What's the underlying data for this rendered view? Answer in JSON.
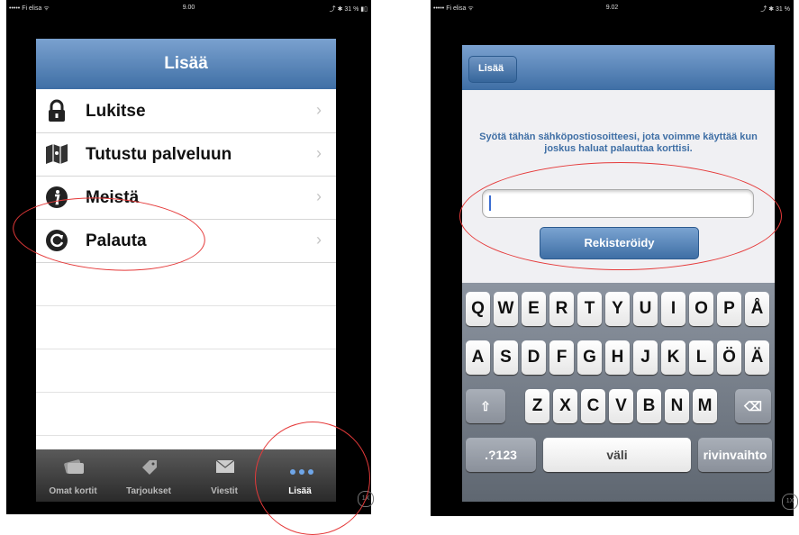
{
  "left": {
    "status": {
      "carrier": "••••• Fi elisa ᯤ",
      "time": "9.00",
      "battery": "⤴ ✱ 31 % ▮▯"
    },
    "title": "Lisää",
    "rows": [
      {
        "label": "Lukitse",
        "icon": "lock-icon"
      },
      {
        "label": "Tutustu palveluun",
        "icon": "map-icon"
      },
      {
        "label": "Meistä",
        "icon": "info-icon"
      },
      {
        "label": "Palauta",
        "icon": "restore-icon"
      }
    ],
    "tabs": [
      {
        "label": "Omat kortit",
        "icon": "cards-icon"
      },
      {
        "label": "Tarjoukset",
        "icon": "tag-icon"
      },
      {
        "label": "Viestit",
        "icon": "envelope-icon"
      },
      {
        "label": "Lisää",
        "icon": "more-dots-icon",
        "active": true
      }
    ],
    "chevron": "›",
    "corner_badge": "1X"
  },
  "right": {
    "status": {
      "carrier": "••••• Fi elisa ᯤ",
      "time": "9.02",
      "battery": "⤴ ✱ 31 %"
    },
    "back_label": "Lisää",
    "instruction": "Syötä tähän sähköpostiosoitteesi, jota voimme käyttää kun joskus haluat palauttaa korttisi.",
    "email_value": "",
    "register_label": "Rekisteröidy",
    "keyboard": {
      "row1": [
        "Q",
        "W",
        "E",
        "R",
        "T",
        "Y",
        "U",
        "I",
        "O",
        "P",
        "Å"
      ],
      "row2": [
        "A",
        "S",
        "D",
        "F",
        "G",
        "H",
        "J",
        "K",
        "L",
        "Ö",
        "Ä"
      ],
      "row3": [
        "Z",
        "X",
        "C",
        "V",
        "B",
        "N",
        "M"
      ],
      "shift": "⇧",
      "backspace": "⌫",
      "numbers": ".?123",
      "space": "väli",
      "return": "rivinvaihto"
    },
    "corner_badge": "1X"
  },
  "colors": {
    "nav": "#3f6fa5",
    "annotation": "#e53a3a"
  }
}
